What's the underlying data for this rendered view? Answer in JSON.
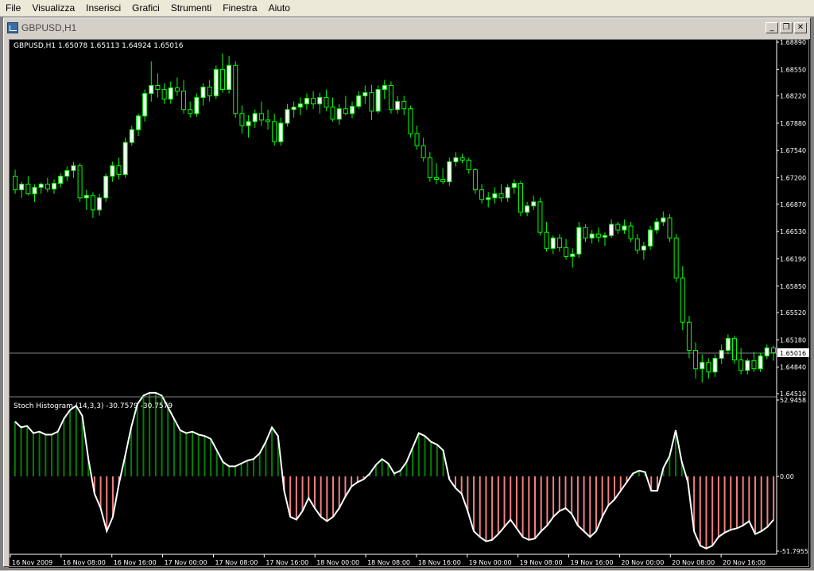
{
  "menu": [
    "File",
    "Visualizza",
    "Inserisci",
    "Grafici",
    "Strumenti",
    "Finestra",
    "Aiuto"
  ],
  "window": {
    "title": "GBPUSD,H1",
    "icon": "chart-window-icon",
    "buttons": {
      "minimize": "_",
      "restore": "❐",
      "close": "✕"
    }
  },
  "price_panel": {
    "label": "GBPUSD,H1  1.65078 1.65113 1.64924 1.65016",
    "current_price_label": "1.65016",
    "current_price": 1.65016,
    "y_ticks": [
      "1.68890",
      "1.68550",
      "1.68220",
      "1.67880",
      "1.67540",
      "1.67200",
      "1.66870",
      "1.66530",
      "1.66190",
      "1.65850",
      "1.65520",
      "1.65180",
      "1.64840",
      "1.64510"
    ]
  },
  "indicator_panel": {
    "label": "Stoch Histogram (14,3,3) -30.7579 -30.7579",
    "y_ticks": [
      "52.9458",
      "0.00",
      "-51.7955"
    ]
  },
  "x_ticks": [
    "16 Nov 2009",
    "16 Nov 08:00",
    "16 Nov 16:00",
    "17 Nov 00:00",
    "17 Nov 08:00",
    "17 Nov 16:00",
    "18 Nov 00:00",
    "18 Nov 08:00",
    "18 Nov 16:00",
    "19 Nov 00:00",
    "19 Nov 08:00",
    "19 Nov 16:00",
    "20 Nov 00:00",
    "20 Nov 08:00",
    "20 Nov 16:00"
  ],
  "colors": {
    "background": "#000000",
    "candle": "#00ff00",
    "bull_body": "#ffffff",
    "bear_body": "#000000",
    "hist_positive": "#008000",
    "hist_negative": "#f08080",
    "stoch_line": "#ffffff",
    "text": "#ffffff"
  },
  "chart_data": [
    {
      "type": "candlestick",
      "title": "GBPUSD,H1",
      "ylim": [
        1.6451,
        1.6889
      ],
      "ohlc": [
        [
          1.6722,
          1.673,
          1.67,
          1.6705
        ],
        [
          1.6705,
          1.6715,
          1.6695,
          1.6712
        ],
        [
          1.6712,
          1.6722,
          1.6698,
          1.67
        ],
        [
          1.67,
          1.6712,
          1.669,
          1.6708
        ],
        [
          1.6708,
          1.6714,
          1.67,
          1.6712
        ],
        [
          1.6712,
          1.672,
          1.6702,
          1.6706
        ],
        [
          1.6706,
          1.6718,
          1.67,
          1.6713
        ],
        [
          1.6713,
          1.6726,
          1.6708,
          1.6722
        ],
        [
          1.6722,
          1.6734,
          1.6716,
          1.6729
        ],
        [
          1.6729,
          1.674,
          1.672,
          1.6735
        ],
        [
          1.6735,
          1.6738,
          1.669,
          1.6695
        ],
        [
          1.6695,
          1.6705,
          1.668,
          1.6698
        ],
        [
          1.6698,
          1.6702,
          1.667,
          1.668
        ],
        [
          1.668,
          1.67,
          1.6673,
          1.6695
        ],
        [
          1.6695,
          1.6725,
          1.669,
          1.6722
        ],
        [
          1.6722,
          1.674,
          1.6715,
          1.6735
        ],
        [
          1.6735,
          1.6745,
          1.6718,
          1.6724
        ],
        [
          1.6724,
          1.677,
          1.672,
          1.6764
        ],
        [
          1.6764,
          1.6785,
          1.676,
          1.678
        ],
        [
          1.678,
          1.68,
          1.6772,
          1.6797
        ],
        [
          1.6797,
          1.683,
          1.679,
          1.6825
        ],
        [
          1.6825,
          1.6865,
          1.6815,
          1.6835
        ],
        [
          1.6835,
          1.685,
          1.682,
          1.683
        ],
        [
          1.683,
          1.6838,
          1.6812,
          1.6818
        ],
        [
          1.6818,
          1.684,
          1.6812,
          1.6832
        ],
        [
          1.6832,
          1.6845,
          1.6822,
          1.6828
        ],
        [
          1.6828,
          1.6842,
          1.68,
          1.6805
        ],
        [
          1.6805,
          1.6815,
          1.6795,
          1.68
        ],
        [
          1.68,
          1.6825,
          1.6796,
          1.682
        ],
        [
          1.682,
          1.6838,
          1.681,
          1.6833
        ],
        [
          1.6833,
          1.6842,
          1.6815,
          1.6822
        ],
        [
          1.6822,
          1.686,
          1.6818,
          1.6855
        ],
        [
          1.6855,
          1.6875,
          1.6826,
          1.683
        ],
        [
          1.683,
          1.6872,
          1.6825,
          1.686
        ],
        [
          1.686,
          1.6865,
          1.6795,
          1.68
        ],
        [
          1.68,
          1.681,
          1.6775,
          1.6785
        ],
        [
          1.6785,
          1.6798,
          1.677,
          1.679
        ],
        [
          1.679,
          1.6805,
          1.6782,
          1.68
        ],
        [
          1.68,
          1.6815,
          1.6785,
          1.6792
        ],
        [
          1.6792,
          1.6805,
          1.678,
          1.679
        ],
        [
          1.679,
          1.68,
          1.676,
          1.6765
        ],
        [
          1.6765,
          1.6795,
          1.676,
          1.6788
        ],
        [
          1.6788,
          1.6812,
          1.6784,
          1.6805
        ],
        [
          1.6805,
          1.6815,
          1.6795,
          1.6808
        ],
        [
          1.6808,
          1.682,
          1.6798,
          1.6812
        ],
        [
          1.6812,
          1.6825,
          1.6805,
          1.6819
        ],
        [
          1.6819,
          1.6828,
          1.6806,
          1.6812
        ],
        [
          1.6812,
          1.6826,
          1.68,
          1.682
        ],
        [
          1.682,
          1.683,
          1.6803,
          1.6808
        ],
        [
          1.6808,
          1.682,
          1.679,
          1.6793
        ],
        [
          1.6793,
          1.6812,
          1.6786,
          1.6806
        ],
        [
          1.6806,
          1.6822,
          1.6798,
          1.68
        ],
        [
          1.68,
          1.6815,
          1.6794,
          1.6809
        ],
        [
          1.6809,
          1.6828,
          1.6806,
          1.6822
        ],
        [
          1.6822,
          1.6835,
          1.6812,
          1.6826
        ],
        [
          1.6826,
          1.6836,
          1.6792,
          1.6803
        ],
        [
          1.6803,
          1.6835,
          1.68,
          1.683
        ],
        [
          1.683,
          1.6842,
          1.6818,
          1.6835
        ],
        [
          1.6835,
          1.684,
          1.68,
          1.6805
        ],
        [
          1.6805,
          1.6822,
          1.68,
          1.6815
        ],
        [
          1.6815,
          1.6822,
          1.6798,
          1.6806
        ],
        [
          1.6806,
          1.681,
          1.677,
          1.6775
        ],
        [
          1.6775,
          1.6785,
          1.6755,
          1.676
        ],
        [
          1.676,
          1.677,
          1.674,
          1.6745
        ],
        [
          1.6745,
          1.6752,
          1.6715,
          1.672
        ],
        [
          1.672,
          1.6738,
          1.6712,
          1.6718
        ],
        [
          1.6718,
          1.6732,
          1.6712,
          1.6715
        ],
        [
          1.6715,
          1.6745,
          1.671,
          1.674
        ],
        [
          1.674,
          1.6752,
          1.6734,
          1.6745
        ],
        [
          1.6745,
          1.675,
          1.6738,
          1.6742
        ],
        [
          1.6742,
          1.6745,
          1.6725,
          1.673
        ],
        [
          1.673,
          1.6732,
          1.67,
          1.6705
        ],
        [
          1.6705,
          1.6712,
          1.6688,
          1.6693
        ],
        [
          1.6693,
          1.6702,
          1.6683,
          1.6695
        ],
        [
          1.6695,
          1.6708,
          1.6688,
          1.67
        ],
        [
          1.67,
          1.6712,
          1.669,
          1.6695
        ],
        [
          1.6695,
          1.6712,
          1.669,
          1.6708
        ],
        [
          1.6708,
          1.6718,
          1.67,
          1.6713
        ],
        [
          1.6713,
          1.6716,
          1.6672,
          1.6677
        ],
        [
          1.6677,
          1.669,
          1.6672,
          1.6685
        ],
        [
          1.6685,
          1.6698,
          1.668,
          1.669
        ],
        [
          1.669,
          1.6695,
          1.6648,
          1.6652
        ],
        [
          1.6652,
          1.6665,
          1.6628,
          1.6632
        ],
        [
          1.6632,
          1.6648,
          1.6625,
          1.6645
        ],
        [
          1.6645,
          1.665,
          1.6628,
          1.6633
        ],
        [
          1.6633,
          1.6644,
          1.6618,
          1.6622
        ],
        [
          1.6622,
          1.6632,
          1.6608,
          1.6625
        ],
        [
          1.6625,
          1.6665,
          1.662,
          1.6658
        ],
        [
          1.6658,
          1.6662,
          1.664,
          1.6645
        ],
        [
          1.6645,
          1.6655,
          1.6638,
          1.665
        ],
        [
          1.665,
          1.6658,
          1.664,
          1.6646
        ],
        [
          1.6646,
          1.6652,
          1.6635,
          1.6648
        ],
        [
          1.6648,
          1.6668,
          1.6645,
          1.6662
        ],
        [
          1.6662,
          1.6665,
          1.665,
          1.6655
        ],
        [
          1.6655,
          1.6668,
          1.665,
          1.666
        ],
        [
          1.666,
          1.6665,
          1.664,
          1.6644
        ],
        [
          1.6644,
          1.665,
          1.6625,
          1.663
        ],
        [
          1.663,
          1.664,
          1.6618,
          1.6635
        ],
        [
          1.6635,
          1.666,
          1.663,
          1.6655
        ],
        [
          1.6655,
          1.667,
          1.665,
          1.6665
        ],
        [
          1.6665,
          1.6678,
          1.666,
          1.667
        ],
        [
          1.667,
          1.6675,
          1.664,
          1.6645
        ],
        [
          1.6645,
          1.665,
          1.659,
          1.6595
        ],
        [
          1.6595,
          1.661,
          1.653,
          1.654
        ],
        [
          1.654,
          1.6548,
          1.6495,
          1.6505
        ],
        [
          1.6505,
          1.6515,
          1.647,
          1.6482
        ],
        [
          1.6482,
          1.65,
          1.6465,
          1.649
        ],
        [
          1.649,
          1.6495,
          1.647,
          1.6478
        ],
        [
          1.6478,
          1.65,
          1.6472,
          1.6495
        ],
        [
          1.6495,
          1.6512,
          1.6488,
          1.6505
        ],
        [
          1.6505,
          1.6525,
          1.65,
          1.652
        ],
        [
          1.652,
          1.6523,
          1.6488,
          1.6493
        ],
        [
          1.6493,
          1.6508,
          1.6475,
          1.648
        ],
        [
          1.648,
          1.6495,
          1.6475,
          1.6492
        ],
        [
          1.6492,
          1.6503,
          1.6478,
          1.6482
        ],
        [
          1.6482,
          1.6502,
          1.6478,
          1.6498
        ],
        [
          1.6498,
          1.6512,
          1.6494,
          1.6508
        ],
        [
          1.6508,
          1.6511,
          1.6492,
          1.6502
        ]
      ]
    },
    {
      "type": "bar",
      "title": "Stoch Histogram (14,3,3)",
      "ylim": [
        -51.7955,
        52.9458
      ],
      "values": [
        38,
        34,
        35,
        30,
        31,
        29,
        29,
        31,
        40,
        46,
        49,
        42,
        12,
        -12,
        -22,
        -38,
        -28,
        -5,
        14,
        34,
        50,
        56,
        58,
        58,
        56,
        48,
        40,
        32,
        30,
        31,
        29,
        28,
        26,
        18,
        10,
        7,
        7,
        9,
        11,
        12,
        16,
        24,
        34,
        28,
        -10,
        -28,
        -30,
        -24,
        -15,
        -22,
        -28,
        -31,
        -28,
        -22,
        -14,
        -7,
        -4,
        -2,
        2,
        8,
        12,
        9,
        2,
        4,
        10,
        20,
        30,
        28,
        24,
        22,
        18,
        -2,
        -8,
        -12,
        -24,
        -38,
        -42,
        -45,
        -44,
        -40,
        -35,
        -30,
        -36,
        -42,
        -44,
        -43,
        -38,
        -34,
        -28,
        -24,
        -22,
        -26,
        -34,
        -38,
        -42,
        -38,
        -28,
        -20,
        -16,
        -10,
        -4,
        2,
        4,
        3,
        -10,
        -10,
        6,
        14,
        32,
        10,
        -4,
        -38,
        -48,
        -50,
        -48,
        -42,
        -39,
        -37,
        -36,
        -34,
        -31,
        -40,
        -38,
        -35,
        -30
      ],
      "line": [
        38,
        34,
        35,
        30,
        31,
        29,
        29,
        31,
        40,
        46,
        49,
        42,
        12,
        -12,
        -22,
        -38,
        -28,
        -5,
        14,
        34,
        50,
        56,
        58,
        58,
        56,
        48,
        40,
        32,
        30,
        31,
        29,
        28,
        26,
        18,
        10,
        7,
        7,
        9,
        11,
        12,
        16,
        24,
        34,
        28,
        -10,
        -28,
        -30,
        -24,
        -15,
        -22,
        -28,
        -31,
        -28,
        -22,
        -14,
        -7,
        -4,
        -2,
        2,
        8,
        12,
        9,
        2,
        4,
        10,
        20,
        30,
        28,
        24,
        22,
        18,
        -2,
        -8,
        -12,
        -24,
        -38,
        -42,
        -45,
        -44,
        -40,
        -35,
        -30,
        -36,
        -42,
        -44,
        -43,
        -38,
        -34,
        -28,
        -24,
        -22,
        -26,
        -34,
        -38,
        -42,
        -38,
        -28,
        -20,
        -16,
        -10,
        -4,
        2,
        4,
        3,
        -10,
        -10,
        6,
        14,
        32,
        10,
        -4,
        -38,
        -48,
        -50,
        -48,
        -42,
        -39,
        -37,
        -36,
        -34,
        -31,
        -40,
        -38,
        -35,
        -30
      ]
    }
  ]
}
